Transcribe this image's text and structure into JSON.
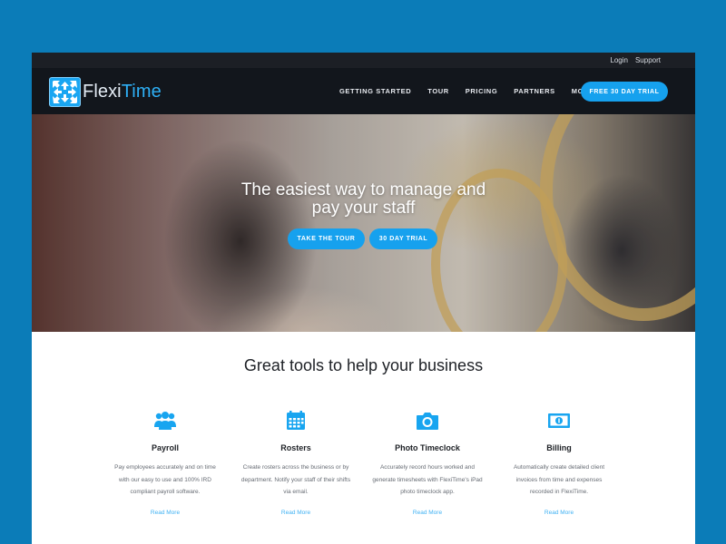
{
  "topbar": {
    "links": [
      "Login",
      "Support"
    ]
  },
  "brand": {
    "part1": "Flexi",
    "part2": "Time"
  },
  "nav": {
    "items": [
      "GETTING STARTED",
      "TOUR",
      "PRICING",
      "PARTNERS",
      "MORE"
    ],
    "cta": "FREE 30 DAY TRIAL"
  },
  "hero": {
    "title_line1": "The easiest way to manage and",
    "title_line2": "pay your staff",
    "btn_tour": "TAKE THE TOUR",
    "btn_trial": "30 DAY TRIAL"
  },
  "tools": {
    "title": "Great tools to help your business",
    "features": [
      {
        "icon": "users-icon",
        "title": "Payroll",
        "lines": [
          "Pay employees accurately and on time",
          "with our easy to use and 100% IRD",
          "compliant payroll software."
        ],
        "link": "Read More"
      },
      {
        "icon": "calendar-icon",
        "title": "Rosters",
        "lines": [
          "Create rosters across the business or by",
          "department. Notify your staff of their shifts",
          "via email."
        ],
        "link": "Read More"
      },
      {
        "icon": "camera-icon",
        "title": "Photo Timeclock",
        "lines": [
          "Accurately record hours worked and",
          "generate timesheets with FlexiTime's iPad",
          "photo timeclock app."
        ],
        "link": "Read More"
      },
      {
        "icon": "money-icon",
        "title": "Billing",
        "lines": [
          "Automatically create detailed client",
          "invoices from time and expenses",
          "recorded in FlexiTime."
        ],
        "link": "Read More"
      }
    ]
  },
  "colors": {
    "accent": "#16a1ee",
    "background": "#0b7cb8",
    "nav_bg": "#12161c"
  }
}
